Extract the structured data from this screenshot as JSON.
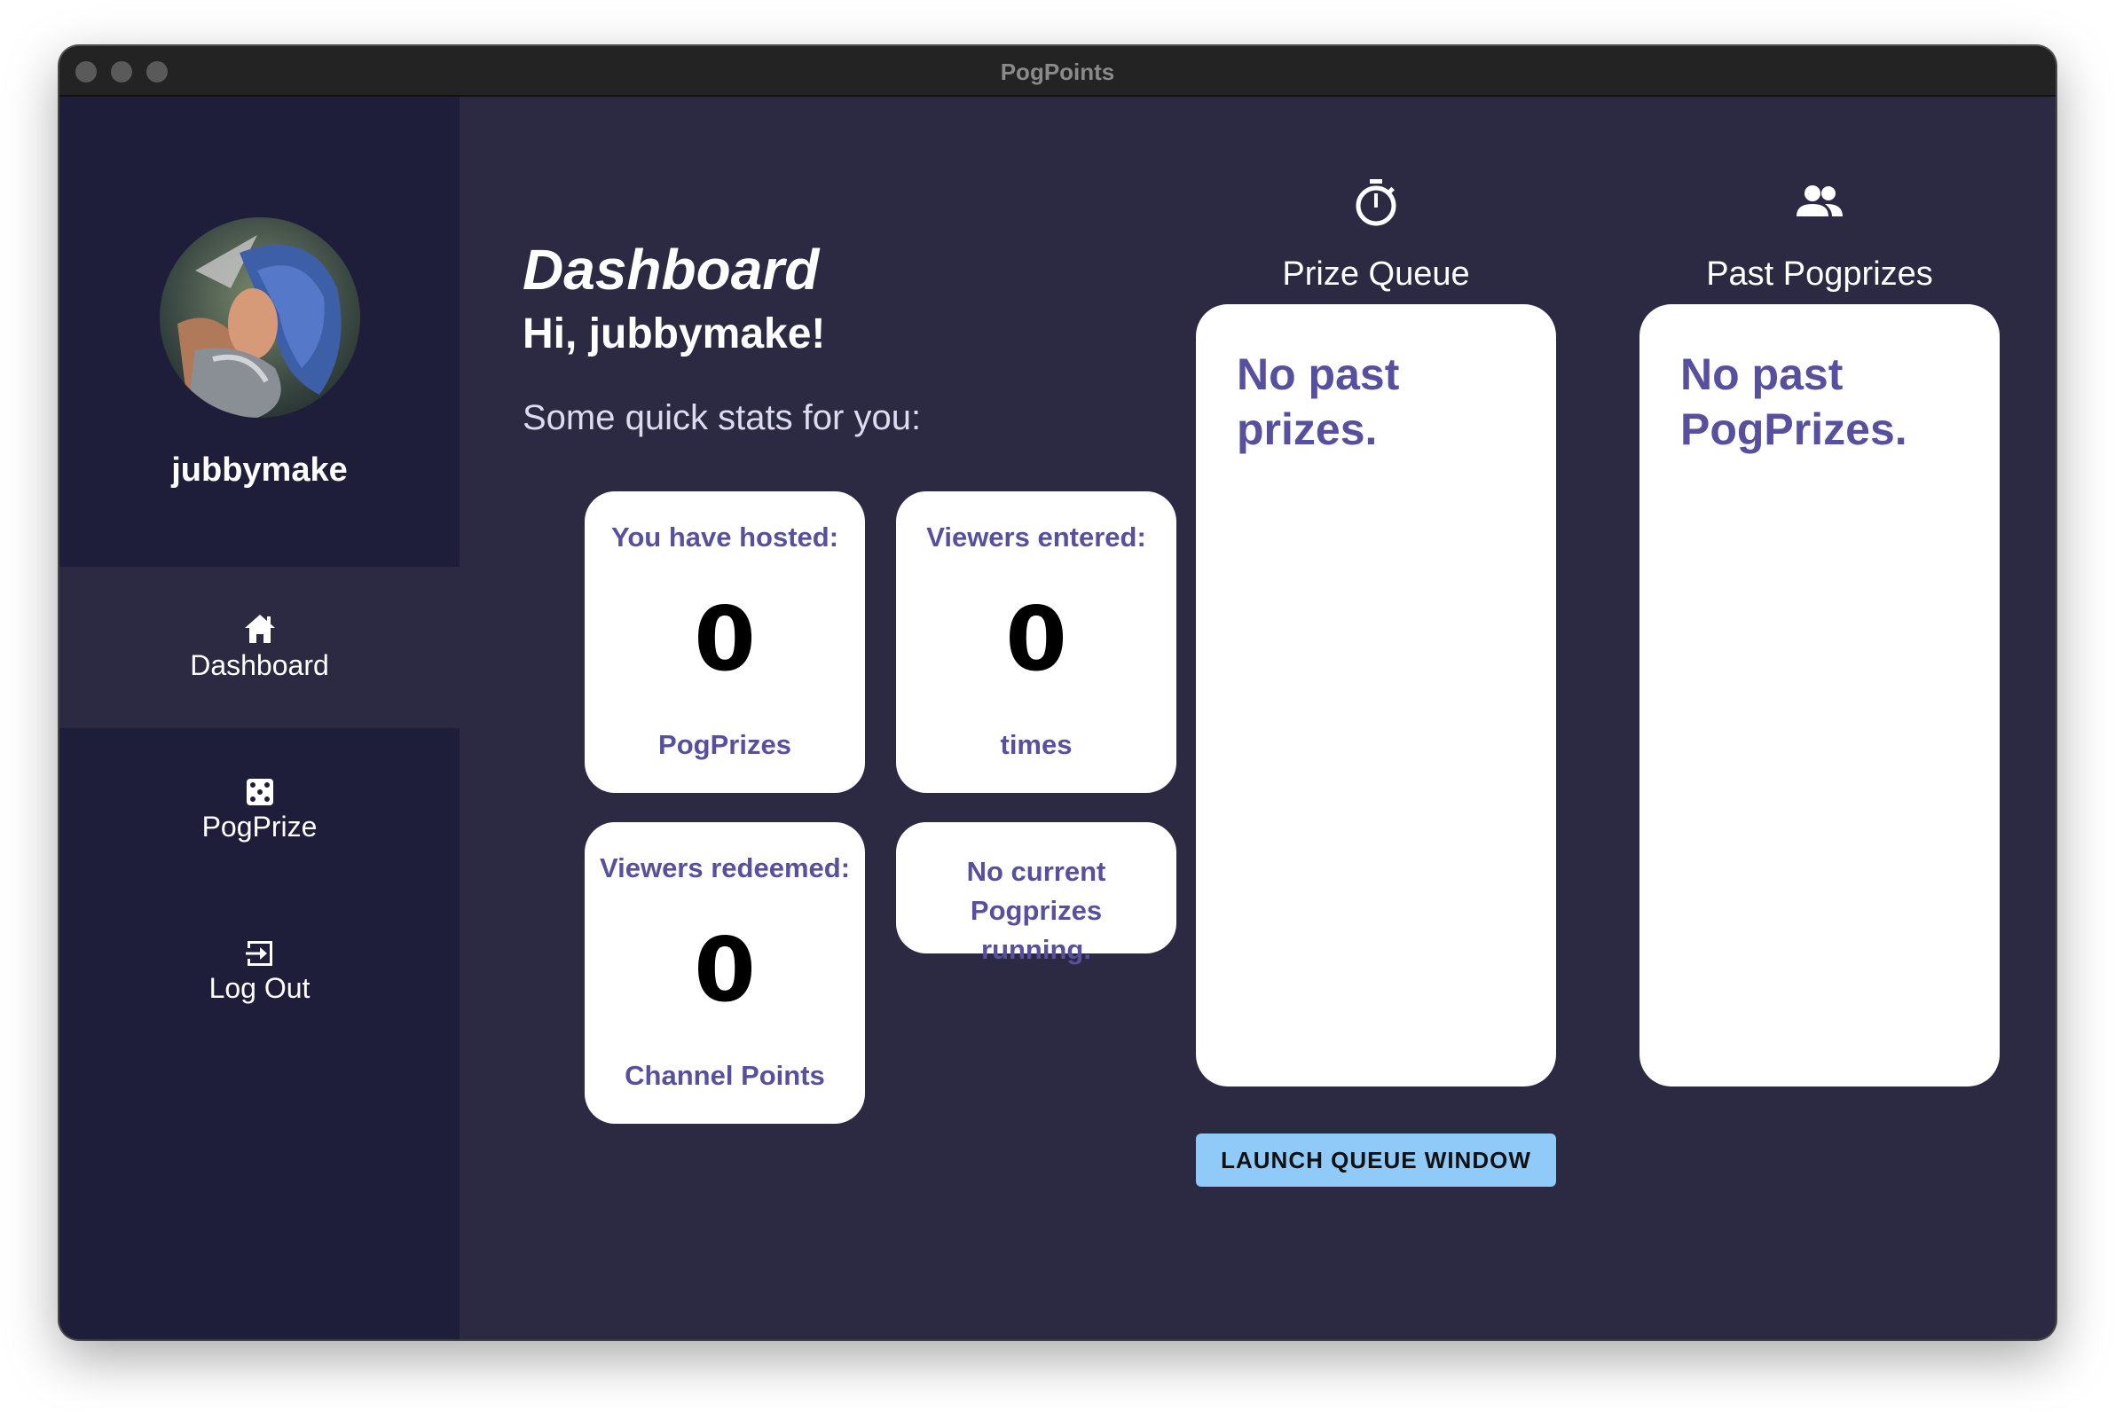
{
  "window": {
    "title": "PogPoints"
  },
  "sidebar": {
    "username": "jubbymake",
    "items": [
      {
        "label": "Dashboard",
        "icon": "home-icon",
        "active": true
      },
      {
        "label": "PogPrize",
        "icon": "dice-icon",
        "active": false
      },
      {
        "label": "Log Out",
        "icon": "logout-icon",
        "active": false
      }
    ]
  },
  "main": {
    "title": "Dashboard",
    "greeting": "Hi, jubbymake!",
    "subtitle": "Some quick stats for you:",
    "stats": [
      {
        "top": "You have hosted:",
        "value": "0",
        "bottom": "PogPrizes"
      },
      {
        "top": "Viewers entered:",
        "value": "0",
        "bottom": "times"
      },
      {
        "top": "Viewers redeemed:",
        "value": "0",
        "bottom": "Channel Points"
      }
    ],
    "running_note": "No current Pogprizes running."
  },
  "prize_queue": {
    "header": "Prize Queue",
    "icon": "timer-icon",
    "empty_message": "No past prizes.",
    "button_label": "LAUNCH QUEUE WINDOW"
  },
  "past_pogprizes": {
    "header": "Past Pogprizes",
    "icon": "people-icon",
    "empty_message": "No past PogPrizes."
  },
  "colors": {
    "background": "#2c2a42",
    "sidebar": "#1f1e3a",
    "accent_text": "#56509e",
    "button": "#90caf9"
  }
}
